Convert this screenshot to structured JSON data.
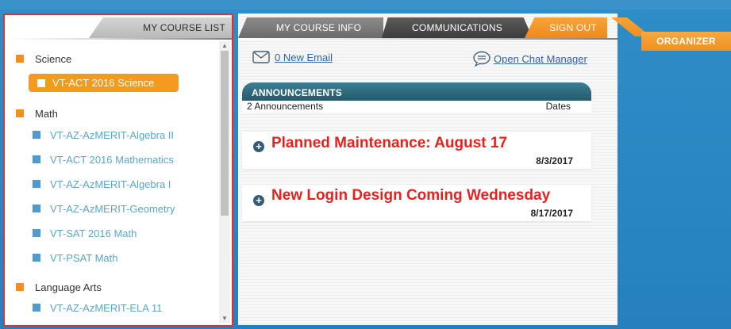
{
  "left_tab": {
    "label": "MY COURSE LIST"
  },
  "top_tabs": {
    "course_info": "MY COURSE INFO",
    "communications": "COMMUNICATIONS",
    "sign_out": "SIGN OUT"
  },
  "organizer": {
    "label": "ORGANIZER"
  },
  "course_list": {
    "categories": [
      {
        "label": "Science",
        "items": [
          "VT-ACT 2016 Science"
        ]
      },
      {
        "label": "Math",
        "items": [
          "VT-AZ-AzMERIT-Algebra II",
          "VT-ACT 2016 Mathematics",
          "VT-AZ-AzMERIT-Algebra I",
          "VT-AZ-AzMERIT-Geometry",
          "VT-SAT 2016 Math",
          "VT-PSAT Math"
        ]
      },
      {
        "label": "Language Arts",
        "items": [
          "VT-AZ-AzMERIT-ELA 11"
        ]
      }
    ],
    "selected": "VT-ACT 2016 Science"
  },
  "links": {
    "email": "0 New Email",
    "chat": "Open Chat Manager"
  },
  "announcements": {
    "header": "ANNOUNCEMENTS",
    "count_label": "2 Announcements",
    "dates_label": "Dates",
    "items": [
      {
        "title": "Planned Maintenance: August 17",
        "date": "8/3/2017"
      },
      {
        "title": "New Login Design Coming Wednesday",
        "date": "8/17/2017"
      }
    ]
  },
  "colors": {
    "accent_orange": "#f39a1f",
    "link_blue": "#2f63a8",
    "item_blue": "#5ba6cc",
    "announcement_red": "#e6211e",
    "header_teal": "#2b6478",
    "outline_red": "#e0332d"
  },
  "icons": {
    "email": "envelope-icon",
    "chat": "chat-bubble-icon",
    "expand": "plus-circle-icon"
  }
}
